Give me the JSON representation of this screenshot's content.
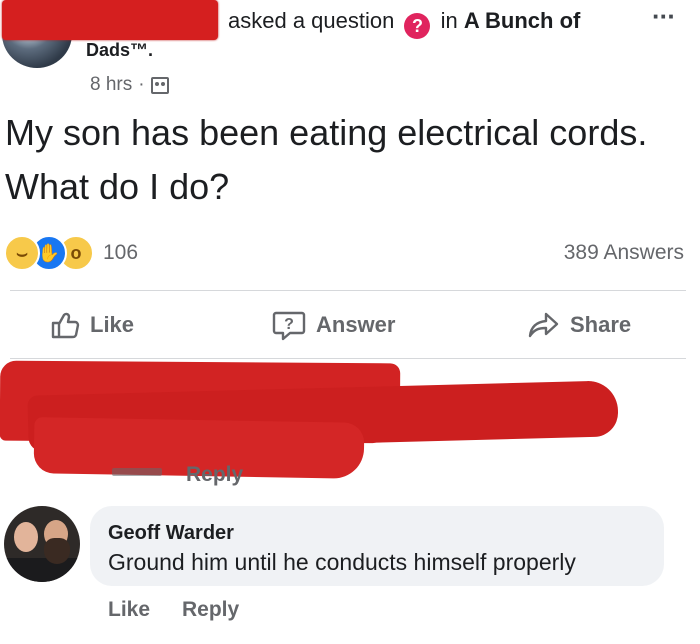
{
  "header": {
    "action_text": "asked a question",
    "in_text": "in",
    "group_name": "A Bunch of",
    "group_name_tail": "Dads™.",
    "more_icon": "ellipsis-icon"
  },
  "post": {
    "time": "8 hrs",
    "separator": "·",
    "audience_icon": "group-icon",
    "question": "My son has been eating electrical cords. What do I do?",
    "reaction_count": "106",
    "reactions": [
      "haha",
      "like",
      "wow"
    ],
    "answers_count": "389 Answers"
  },
  "actions": {
    "like": "Like",
    "answer": "Answer",
    "share": "Share"
  },
  "first_comment": {
    "reply": "Reply"
  },
  "comment": {
    "author": "Geoff Warder",
    "text": "Ground him until he conducts himself properly",
    "like": "Like",
    "reply": "Reply"
  },
  "colors": {
    "redaction": "#d22323",
    "question_badge": "#e0245e",
    "like_blue": "#1877f2",
    "muted_text": "#65676b",
    "bubble_bg": "#f0f2f5"
  }
}
